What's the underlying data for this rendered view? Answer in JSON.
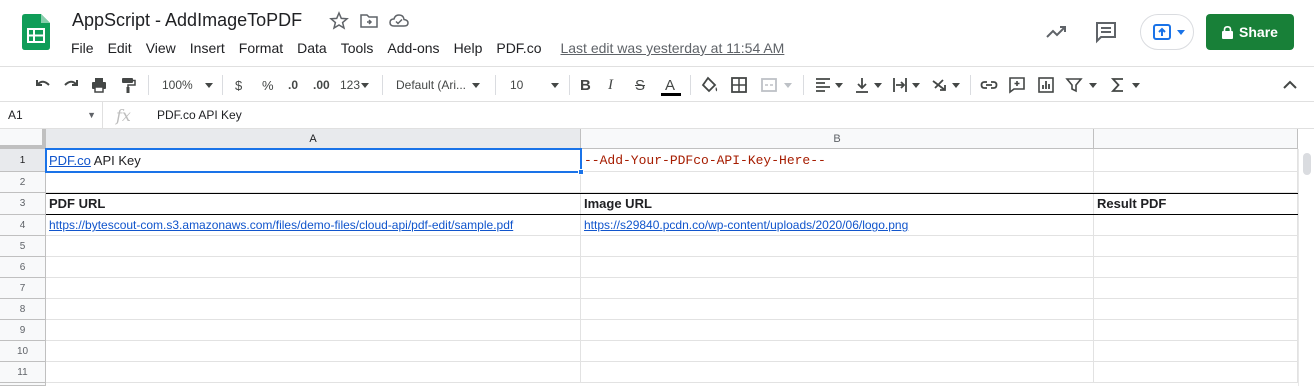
{
  "doc": {
    "title": "AppScript - AddImageToPDF",
    "last_edit": "Last edit was yesterday at 11:54 AM",
    "share_label": "Share"
  },
  "menu": [
    "File",
    "Edit",
    "View",
    "Insert",
    "Format",
    "Data",
    "Tools",
    "Add-ons",
    "Help",
    "PDF.co"
  ],
  "toolbar": {
    "zoom": "100%",
    "currency": "$",
    "percent": "%",
    "dec_decrease": ".0",
    "dec_increase": ".00",
    "more_formats": "123",
    "font": "Default (Ari...",
    "font_size": "10",
    "bold": "B",
    "italic": "I",
    "strike": "S",
    "text_color_glyph": "A",
    "text_color_bar": "#000000"
  },
  "formula_bar": {
    "cell_ref": "A1",
    "fx": "fx",
    "value": "PDF.co API Key"
  },
  "columns": [
    "A",
    "B"
  ],
  "rows": [
    "1",
    "2",
    "3",
    "4",
    "5",
    "6",
    "7",
    "8",
    "9",
    "10",
    "11"
  ],
  "cells": {
    "a1_link": "PDF.co",
    "a1_rest": " API Key",
    "b1": "--Add-Your-PDFco-API-Key-Here--",
    "a3": "PDF URL",
    "b3": "Image URL",
    "c3": "Result PDF",
    "a4": "https://bytescout-com.s3.amazonaws.com/files/demo-files/cloud-api/pdf-edit/sample.pdf",
    "b4": "https://s29840.pcdn.co/wp-content/uploads/2020/06/logo.png"
  },
  "colors": {
    "share_bg": "#188038",
    "selection": "#1a73e8",
    "link": "#1155cc",
    "mono_text": "#a61c00",
    "sheets_green": "#0f9d58"
  }
}
